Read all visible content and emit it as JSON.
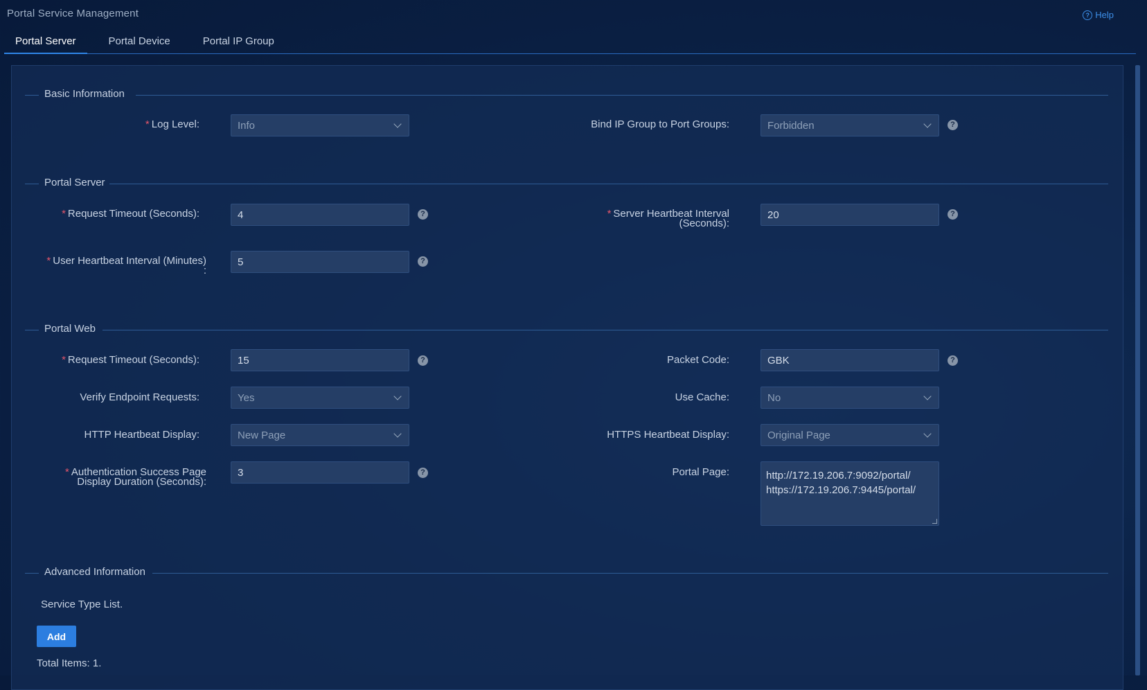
{
  "page": {
    "title": "Portal Service Management",
    "help": "Help"
  },
  "tabs": [
    "Portal Server",
    "Portal Device",
    "Portal IP Group"
  ],
  "basic": {
    "title": "Basic Information",
    "log_level": {
      "label": "Log Level:",
      "value": "Info"
    },
    "bind_ip": {
      "label": "Bind IP Group to Port Groups:",
      "value": "Forbidden"
    }
  },
  "server": {
    "title": "Portal Server",
    "request_timeout": {
      "label": "Request Timeout (Seconds):",
      "value": "4"
    },
    "server_heartbeat": {
      "label_line1": "Server Heartbeat Interval",
      "label_line2": "(Seconds):",
      "value": "20"
    },
    "user_heartbeat": {
      "label_line1": "User Heartbeat Interval (Minutes)",
      "label_line2": ":",
      "value": "5"
    }
  },
  "web": {
    "title": "Portal Web",
    "request_timeout": {
      "label": "Request Timeout (Seconds):",
      "value": "15"
    },
    "packet_code": {
      "label": "Packet Code:",
      "value": "GBK"
    },
    "verify": {
      "label": "Verify Endpoint Requests:",
      "value": "Yes"
    },
    "use_cache": {
      "label": "Use Cache:",
      "value": "No"
    },
    "http_hb": {
      "label": "HTTP Heartbeat Display:",
      "value": "New Page"
    },
    "https_hb": {
      "label": "HTTPS Heartbeat Display:",
      "value": "Original Page"
    },
    "auth_success": {
      "label_line1": "Authentication Success Page",
      "label_line2": "Display Duration (Seconds):",
      "value": "3"
    },
    "portal_page": {
      "label": "Portal Page:",
      "value": "http://172.19.206.7:9092/portal/\nhttps://172.19.206.7:9445/portal/"
    }
  },
  "advanced": {
    "title": "Advanced Information",
    "service_list": "Service Type List.",
    "add": "Add",
    "total": "Total Items: 1."
  }
}
